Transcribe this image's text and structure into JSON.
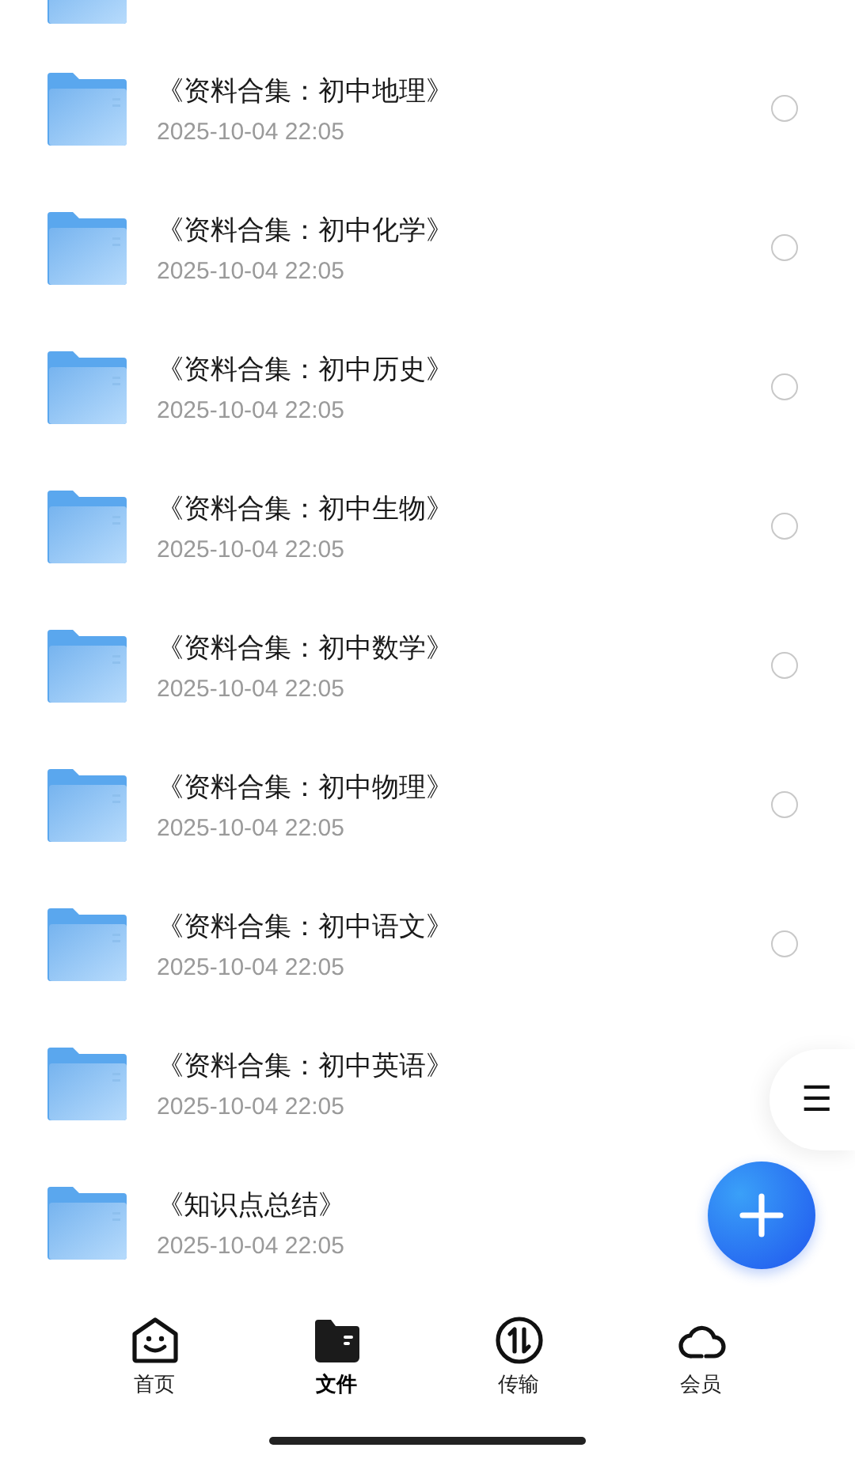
{
  "files": [
    {
      "name": "《资料合集：初中地理》",
      "date": "2025-10-04 22:05",
      "selected": false
    },
    {
      "name": "《资料合集：初中化学》",
      "date": "2025-10-04 22:05",
      "selected": false
    },
    {
      "name": "《资料合集：初中历史》",
      "date": "2025-10-04 22:05",
      "selected": false
    },
    {
      "name": "《资料合集：初中生物》",
      "date": "2025-10-04 22:05",
      "selected": false
    },
    {
      "name": "《资料合集：初中数学》",
      "date": "2025-10-04 22:05",
      "selected": false
    },
    {
      "name": "《资料合集：初中物理》",
      "date": "2025-10-04 22:05",
      "selected": false
    },
    {
      "name": "《资料合集：初中语文》",
      "date": "2025-10-04 22:05",
      "selected": false
    },
    {
      "name": "《资料合集：初中英语》",
      "date": "2025-10-04 22:05"
    },
    {
      "name": "《知识点总结》",
      "date": "2025-10-04 22:05"
    }
  ],
  "menu_button": {
    "label": "☰"
  },
  "tabs": [
    {
      "kind": "home",
      "label": "首页",
      "selected": false
    },
    {
      "kind": "files",
      "label": "文件",
      "selected": true
    },
    {
      "kind": "transfer",
      "label": "传输",
      "selected": false
    },
    {
      "kind": "member",
      "label": "会员",
      "selected": false
    }
  ]
}
